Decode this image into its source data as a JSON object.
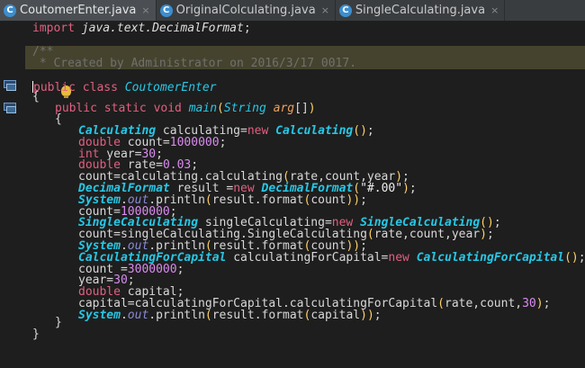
{
  "tabs": [
    {
      "label": "CoutomerEnter.java",
      "close": "×",
      "active": true,
      "icon": "class-c-icon"
    },
    {
      "label": "OriginalColculating.java",
      "close": "×",
      "active": false,
      "icon": "class-c-icon"
    },
    {
      "label": "SingleCalculating.java",
      "close": "×",
      "active": false,
      "icon": "class-c-icon"
    }
  ],
  "gutter_icons": [
    "implements-icon",
    "implements-icon",
    "intention-bulb-icon"
  ],
  "code": {
    "import_kw": "import",
    "import_pkg": "java.text.DecimalFormat",
    "comment_open": "/**",
    "comment_body": " * Created by Administrator on 2016/3/17 0017.",
    "class_kw": "public class",
    "class_name": "CoutomerEnter",
    "brace_open": "{",
    "brace_close": "}",
    "main_kw": "public static void",
    "main_name": "main",
    "main_param_type": "String",
    "main_param_name": "arg",
    "main_param_brackets": "[]",
    "lines": [
      "Calculating calculating=new Calculating();",
      "double count=1000000;",
      "int year=30;",
      "double rate=0.03;",
      "count=calculating.calculating(rate,count,year);",
      "DecimalFormat result =new DecimalFormat(\"#.00\");",
      "System.out.println(result.format(count));",
      "count=1000000;",
      "SingleCalculating singleCalculating=new SingleCalculating();",
      "count=singleCalculating.SingleCalculating(rate,count,year);",
      "System.out.println(result.format(count));",
      "CalculatingForCapital calculatingForCapital=new CalculatingForCapital();",
      "count =3000000;",
      "year=30;",
      "double capital;",
      "capital=calculatingForCapital.calculatingForCapital(rate,count,30);",
      "System.out.println(result.format(capital));"
    ]
  }
}
